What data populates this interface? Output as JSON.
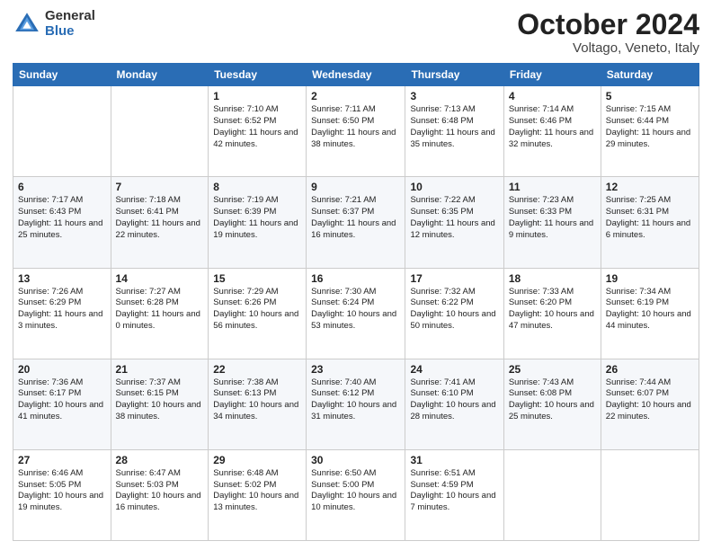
{
  "header": {
    "logo_general": "General",
    "logo_blue": "Blue",
    "month_title": "October 2024",
    "location": "Voltago, Veneto, Italy"
  },
  "weekdays": [
    "Sunday",
    "Monday",
    "Tuesday",
    "Wednesday",
    "Thursday",
    "Friday",
    "Saturday"
  ],
  "weeks": [
    [
      {
        "day": "",
        "info": ""
      },
      {
        "day": "",
        "info": ""
      },
      {
        "day": "1",
        "info": "Sunrise: 7:10 AM\nSunset: 6:52 PM\nDaylight: 11 hours and 42 minutes."
      },
      {
        "day": "2",
        "info": "Sunrise: 7:11 AM\nSunset: 6:50 PM\nDaylight: 11 hours and 38 minutes."
      },
      {
        "day": "3",
        "info": "Sunrise: 7:13 AM\nSunset: 6:48 PM\nDaylight: 11 hours and 35 minutes."
      },
      {
        "day": "4",
        "info": "Sunrise: 7:14 AM\nSunset: 6:46 PM\nDaylight: 11 hours and 32 minutes."
      },
      {
        "day": "5",
        "info": "Sunrise: 7:15 AM\nSunset: 6:44 PM\nDaylight: 11 hours and 29 minutes."
      }
    ],
    [
      {
        "day": "6",
        "info": "Sunrise: 7:17 AM\nSunset: 6:43 PM\nDaylight: 11 hours and 25 minutes."
      },
      {
        "day": "7",
        "info": "Sunrise: 7:18 AM\nSunset: 6:41 PM\nDaylight: 11 hours and 22 minutes."
      },
      {
        "day": "8",
        "info": "Sunrise: 7:19 AM\nSunset: 6:39 PM\nDaylight: 11 hours and 19 minutes."
      },
      {
        "day": "9",
        "info": "Sunrise: 7:21 AM\nSunset: 6:37 PM\nDaylight: 11 hours and 16 minutes."
      },
      {
        "day": "10",
        "info": "Sunrise: 7:22 AM\nSunset: 6:35 PM\nDaylight: 11 hours and 12 minutes."
      },
      {
        "day": "11",
        "info": "Sunrise: 7:23 AM\nSunset: 6:33 PM\nDaylight: 11 hours and 9 minutes."
      },
      {
        "day": "12",
        "info": "Sunrise: 7:25 AM\nSunset: 6:31 PM\nDaylight: 11 hours and 6 minutes."
      }
    ],
    [
      {
        "day": "13",
        "info": "Sunrise: 7:26 AM\nSunset: 6:29 PM\nDaylight: 11 hours and 3 minutes."
      },
      {
        "day": "14",
        "info": "Sunrise: 7:27 AM\nSunset: 6:28 PM\nDaylight: 11 hours and 0 minutes."
      },
      {
        "day": "15",
        "info": "Sunrise: 7:29 AM\nSunset: 6:26 PM\nDaylight: 10 hours and 56 minutes."
      },
      {
        "day": "16",
        "info": "Sunrise: 7:30 AM\nSunset: 6:24 PM\nDaylight: 10 hours and 53 minutes."
      },
      {
        "day": "17",
        "info": "Sunrise: 7:32 AM\nSunset: 6:22 PM\nDaylight: 10 hours and 50 minutes."
      },
      {
        "day": "18",
        "info": "Sunrise: 7:33 AM\nSunset: 6:20 PM\nDaylight: 10 hours and 47 minutes."
      },
      {
        "day": "19",
        "info": "Sunrise: 7:34 AM\nSunset: 6:19 PM\nDaylight: 10 hours and 44 minutes."
      }
    ],
    [
      {
        "day": "20",
        "info": "Sunrise: 7:36 AM\nSunset: 6:17 PM\nDaylight: 10 hours and 41 minutes."
      },
      {
        "day": "21",
        "info": "Sunrise: 7:37 AM\nSunset: 6:15 PM\nDaylight: 10 hours and 38 minutes."
      },
      {
        "day": "22",
        "info": "Sunrise: 7:38 AM\nSunset: 6:13 PM\nDaylight: 10 hours and 34 minutes."
      },
      {
        "day": "23",
        "info": "Sunrise: 7:40 AM\nSunset: 6:12 PM\nDaylight: 10 hours and 31 minutes."
      },
      {
        "day": "24",
        "info": "Sunrise: 7:41 AM\nSunset: 6:10 PM\nDaylight: 10 hours and 28 minutes."
      },
      {
        "day": "25",
        "info": "Sunrise: 7:43 AM\nSunset: 6:08 PM\nDaylight: 10 hours and 25 minutes."
      },
      {
        "day": "26",
        "info": "Sunrise: 7:44 AM\nSunset: 6:07 PM\nDaylight: 10 hours and 22 minutes."
      }
    ],
    [
      {
        "day": "27",
        "info": "Sunrise: 6:46 AM\nSunset: 5:05 PM\nDaylight: 10 hours and 19 minutes."
      },
      {
        "day": "28",
        "info": "Sunrise: 6:47 AM\nSunset: 5:03 PM\nDaylight: 10 hours and 16 minutes."
      },
      {
        "day": "29",
        "info": "Sunrise: 6:48 AM\nSunset: 5:02 PM\nDaylight: 10 hours and 13 minutes."
      },
      {
        "day": "30",
        "info": "Sunrise: 6:50 AM\nSunset: 5:00 PM\nDaylight: 10 hours and 10 minutes."
      },
      {
        "day": "31",
        "info": "Sunrise: 6:51 AM\nSunset: 4:59 PM\nDaylight: 10 hours and 7 minutes."
      },
      {
        "day": "",
        "info": ""
      },
      {
        "day": "",
        "info": ""
      }
    ]
  ]
}
